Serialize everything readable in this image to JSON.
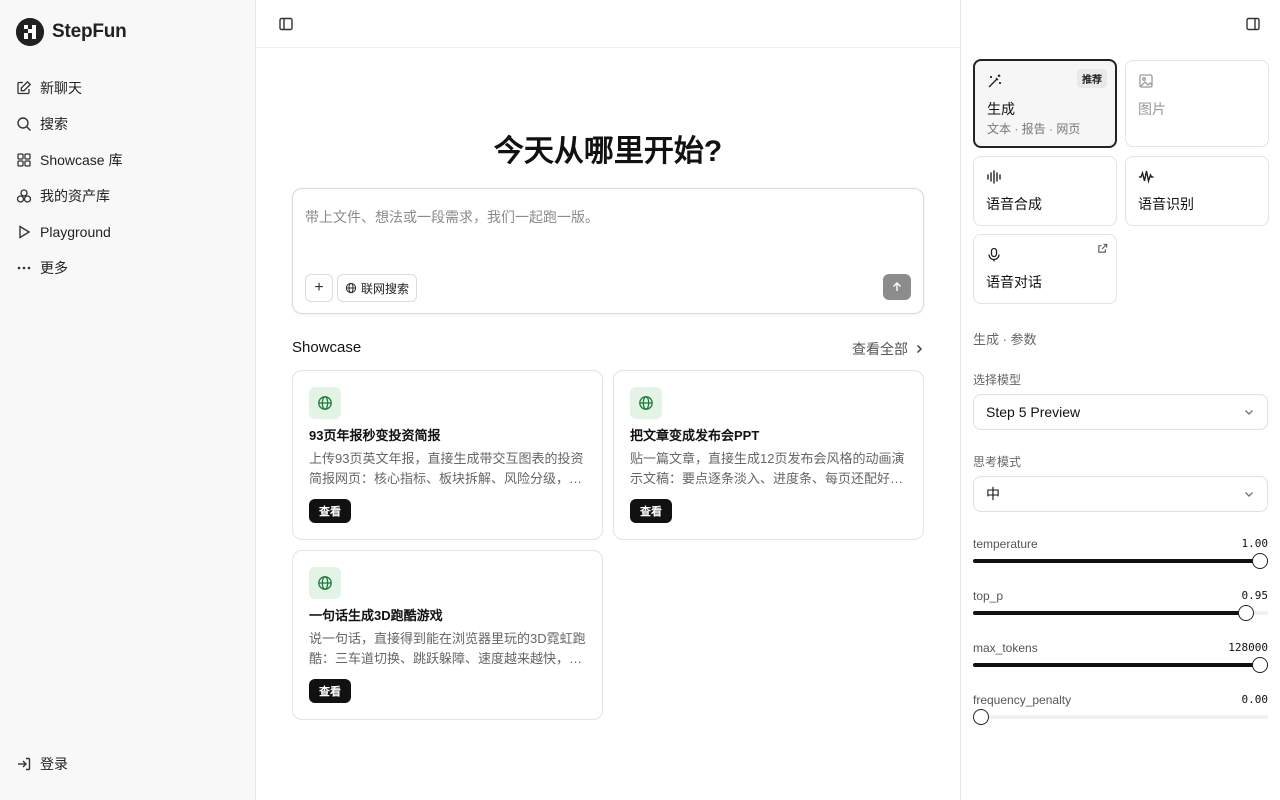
{
  "brand": {
    "name": "StepFun"
  },
  "sidebar": {
    "items": [
      {
        "label": "新聊天",
        "icon": "edit-icon"
      },
      {
        "label": "搜索",
        "icon": "search-icon"
      },
      {
        "label": "Showcase 库",
        "icon": "grid-icon"
      },
      {
        "label": "我的资产库",
        "icon": "assets-icon"
      },
      {
        "label": "Playground",
        "icon": "play-icon"
      },
      {
        "label": "更多",
        "icon": "more-icon"
      }
    ],
    "login_label": "登录"
  },
  "main": {
    "headline": "今天从哪里开始?",
    "composer": {
      "placeholder": "带上文件、想法或一段需求，我们一起跑一版。",
      "plus": "+",
      "web_search_label": "联网搜索"
    },
    "showcase": {
      "title": "Showcase",
      "view_all": "查看全部",
      "cards": [
        {
          "title": "93页年报秒变投资简报",
          "desc": "上传93页英文年报，直接生成带交互图表的投资简报网页：核心指标、板块拆解、风险分级，每一项都能追溯到原文。",
          "button": "查看"
        },
        {
          "title": "把文章变成发布会PPT",
          "desc": "贴一篇文章，直接生成12页发布会风格的动画演示文稿：要点逐条淡入、进度条、每页还配好演讲备注。",
          "button": "查看"
        },
        {
          "title": "一句话生成3D跑酷游戏",
          "desc": "说一句话，直接得到能在浏览器里玩的3D霓虹跑酷：三车道切换、跳跃躲障、速度越来越快，自动计分。",
          "button": "查看"
        }
      ]
    }
  },
  "right_panel": {
    "modes": [
      {
        "label": "生成",
        "sub": "文本 · 报告 · 网页",
        "badge": "推荐",
        "icon": "magic-wand-icon",
        "selected": true
      },
      {
        "label": "图片",
        "icon": "image-icon",
        "disabled": true
      },
      {
        "label": "语音合成",
        "icon": "audio-wave-icon"
      },
      {
        "label": "语音识别",
        "icon": "waveform-icon"
      },
      {
        "label": "语音对话",
        "icon": "microphone-icon",
        "external": true
      }
    ],
    "section_title": "生成 · 参数",
    "model": {
      "label": "选择模型",
      "value": "Step 5 Preview"
    },
    "think": {
      "label": "思考模式",
      "value": "中"
    },
    "params": [
      {
        "name": "temperature",
        "value": "1.00",
        "fraction": 1.0
      },
      {
        "name": "top_p",
        "value": "0.95",
        "fraction": 0.95
      },
      {
        "name": "max_tokens",
        "value": "128000",
        "fraction": 1.0
      },
      {
        "name": "frequency_penalty",
        "value": "0.00",
        "fraction": 0.0
      }
    ]
  }
}
